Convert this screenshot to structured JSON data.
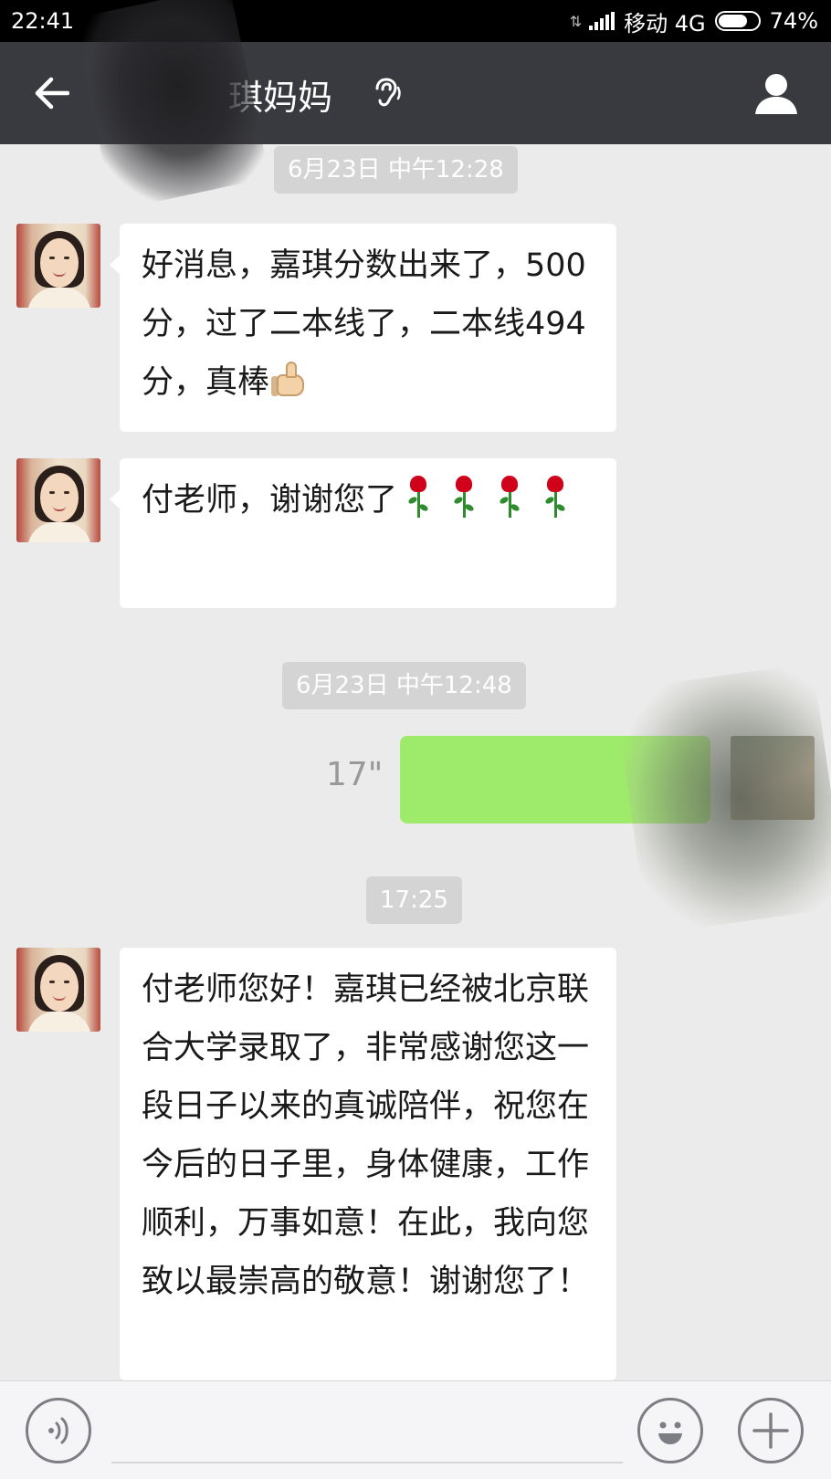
{
  "status_bar": {
    "time": "22:41",
    "carrier": "移动 4G",
    "battery": "74%",
    "battery_level": 0.74
  },
  "header": {
    "title": "琪妈妈",
    "icons": [
      "back-arrow-icon",
      "ear-icon",
      "profile-icon"
    ]
  },
  "messages": [
    {
      "type": "timestamp",
      "text": "6月23日 中午12:28"
    },
    {
      "type": "incoming",
      "text": "好消息，嘉琪分数出来了，500分，过了二本线了，二本线494分，真棒",
      "emoji": "thumbs-up-icon"
    },
    {
      "type": "incoming",
      "text": "付老师，谢谢您了",
      "emoji": "rose-icon",
      "emoji_count": 4
    },
    {
      "type": "timestamp",
      "text": "6月23日 中午12:48"
    },
    {
      "type": "outgoing-voice",
      "duration": "17\""
    },
    {
      "type": "timestamp",
      "text": "17:25"
    },
    {
      "type": "incoming",
      "text": "付老师您好！嘉琪已经被北京联合大学录取了，非常感谢您这一段日子以来的真诚陪伴，祝您在今后的日子里，身体健康，工作顺利，万事如意！在此，我向您致以最崇高的敬意！谢谢您了！"
    }
  ],
  "input_bar": {
    "icons": [
      "voice-icon",
      "emoji-icon",
      "plus-icon"
    ]
  },
  "colors": {
    "status_bar": "#000000",
    "title_bar": "#393a3f",
    "chat_background": "#ebebeb",
    "incoming_bubble": "#ffffff",
    "outgoing_bubble": "#9eea6a",
    "timestamp_bg": "#d4d4d4"
  }
}
